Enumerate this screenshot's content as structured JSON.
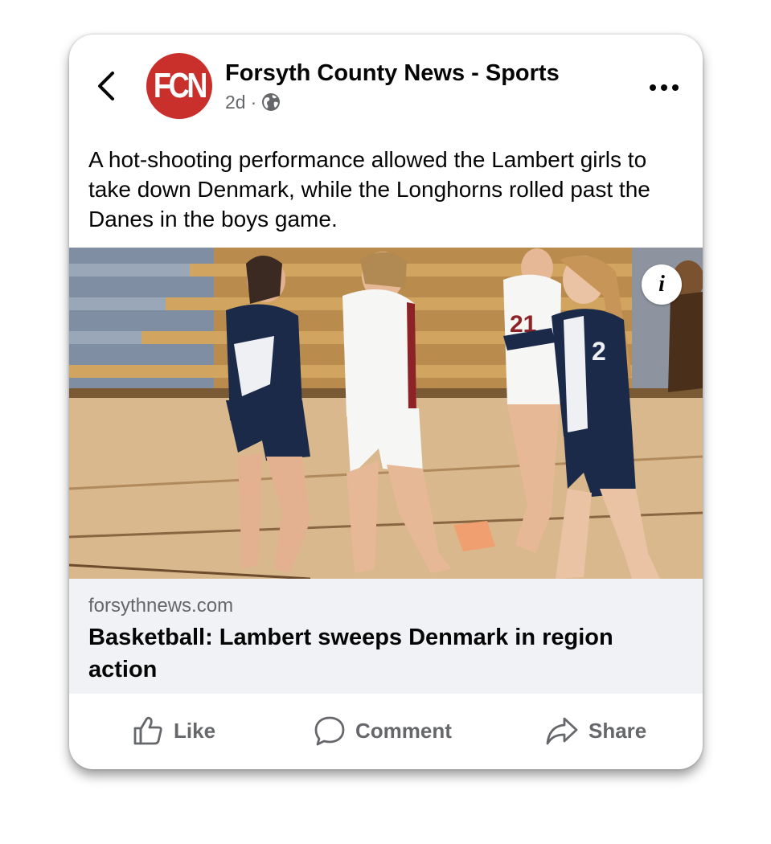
{
  "header": {
    "page_name": "Forsyth County News - Sports",
    "logo_text": "FCN",
    "time": "2d",
    "separator": "·",
    "back_icon": "chevron-left-icon",
    "more_icon": "more-horizontal-icon",
    "privacy_icon": "globe-icon"
  },
  "post": {
    "caption": "A hot-shooting performance allowed the Lambert girls to take down Denmark, while the Longhorns rolled past the Danes in the boys game."
  },
  "photo": {
    "info_label": "i",
    "jersey_numbers": [
      "21",
      "2"
    ]
  },
  "link": {
    "domain": "forsythnews.com",
    "title": "Basketball: Lambert sweeps Denmark in region action"
  },
  "actions": {
    "like": "Like",
    "comment": "Comment",
    "share": "Share"
  },
  "colors": {
    "brand_red": "#c9302c",
    "text_primary": "#050505",
    "text_secondary": "#65676b",
    "link_bg": "#f0f2f5"
  }
}
